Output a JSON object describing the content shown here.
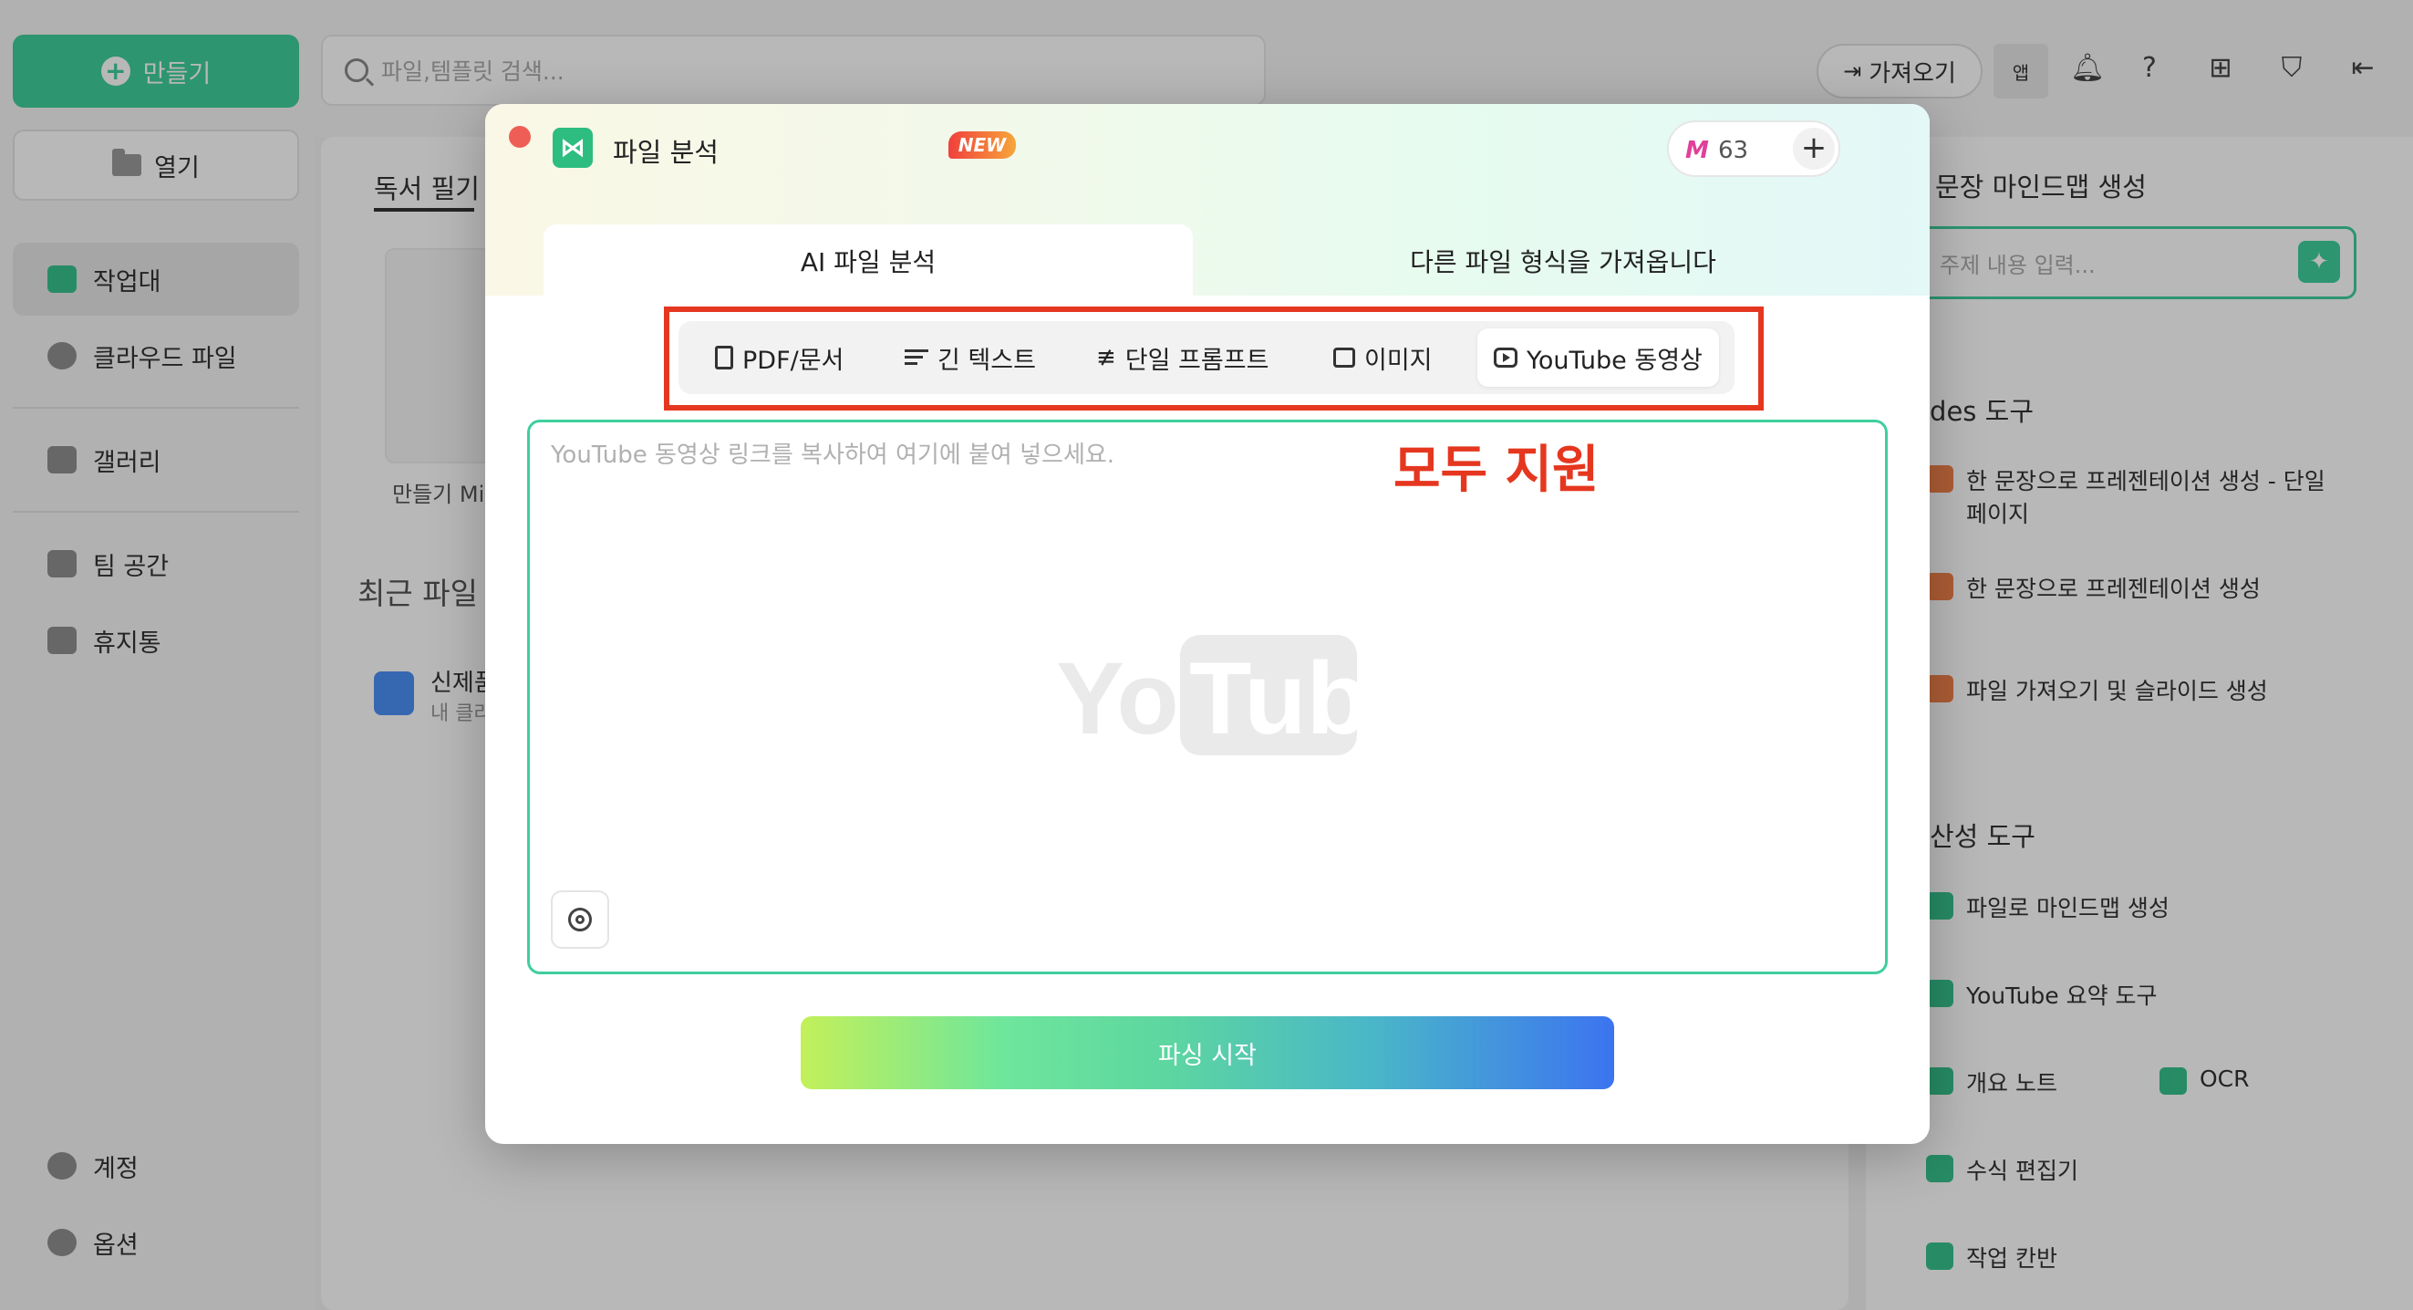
{
  "sidebar": {
    "new_label": "만들기",
    "open_label": "열기",
    "items": [
      {
        "label": "작업대"
      },
      {
        "label": "클라우드 파일"
      },
      {
        "label": "갤러리"
      },
      {
        "label": "팀 공간"
      },
      {
        "label": "휴지통"
      }
    ],
    "account_label": "계정",
    "options_label": "옵션"
  },
  "topbar": {
    "search_placeholder": "파일,템플릿 검색...",
    "import_label": "가져오기",
    "app_label": "앱"
  },
  "main": {
    "tab_label": "독서 필기",
    "thumb_label": "만들기 Mi",
    "recent_title": "최근 파일",
    "recent_file_name": "신제품",
    "recent_file_sub": "내 클라"
  },
  "right_panel": {
    "section1_title": "문장 마인드맵 생성",
    "topic_placeholder": "주제 내용 입력...",
    "section2_title": "ides 도구",
    "slides_items": [
      {
        "label": "한 문장으로 프레젠테이션 생성 - 단일",
        "label2": "페이지"
      },
      {
        "label": "한 문장으로 프레젠테이션 생성"
      },
      {
        "label": "파일 가져오기 및 슬라이드 생성"
      }
    ],
    "section3_title": "산성 도구",
    "tools": [
      {
        "label": "파일로 마인드맵 생성"
      },
      {
        "label": "YouTube 요약 도구"
      },
      {
        "label": "개요 노트"
      },
      {
        "label": "OCR"
      },
      {
        "label": "수식 편집기"
      },
      {
        "label": "작업 칸반"
      }
    ]
  },
  "modal": {
    "title": "파일 분석",
    "credits": "63",
    "tabs": [
      {
        "label": "AI 파일 분석",
        "badge": "NEW"
      },
      {
        "label": "다른 파일 형식을 가져옵니다"
      }
    ],
    "types": [
      {
        "label": "PDF/문서",
        "icon": "document-icon"
      },
      {
        "label": "긴 텍스트",
        "icon": "lines-icon"
      },
      {
        "label": "단일 프롬프트",
        "icon": "prompt-icon"
      },
      {
        "label": "이미지",
        "icon": "image-icon"
      },
      {
        "label": "YouTube 동영상",
        "icon": "play-icon",
        "selected": true
      }
    ],
    "annotation": "모두 지원",
    "input_placeholder": "YouTube 동영상 링크를 복사하여 여기에 붙여 넣으세요.",
    "parse_button": "파싱 시작"
  },
  "colors": {
    "accent": "#3fcf9c",
    "highlight_box": "#e5371f",
    "close_dot": "#ee5e57"
  }
}
